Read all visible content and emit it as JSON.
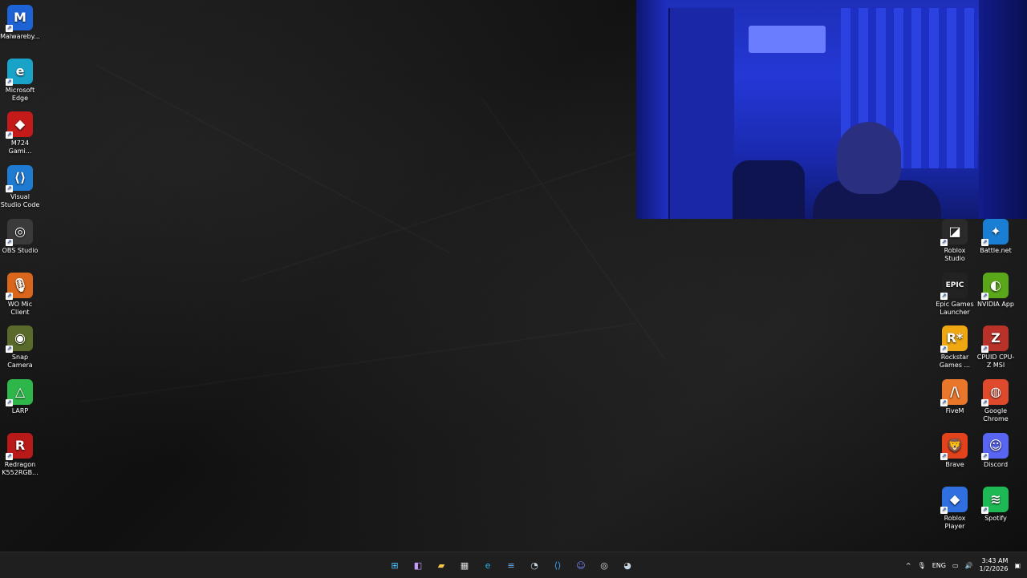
{
  "desktop": {
    "left_icons": [
      {
        "name": "malwarebytes",
        "label": "Malwareby...",
        "glyph": "M",
        "color": "#1e63d6"
      },
      {
        "name": "microsoft-edge",
        "label": "Microsoft Edge",
        "glyph": "e",
        "color": "#1aa3c9"
      },
      {
        "name": "m724-gaming",
        "label": "M724 Gami...",
        "glyph": "◆",
        "color": "#c41a1a"
      },
      {
        "name": "visual-studio-code",
        "label": "Visual Studio Code",
        "glyph": "⟨⟩",
        "color": "#1f7bd1"
      },
      {
        "name": "obs-studio",
        "label": "OBS Studio",
        "glyph": "◎",
        "color": "#3a3a3a"
      },
      {
        "name": "wo-mic-client",
        "label": "WO Mic Client",
        "glyph": "🎙",
        "color": "#d9661a"
      },
      {
        "name": "snap-camera",
        "label": "Snap Camera",
        "glyph": "◉",
        "color": "#5a6a2a"
      },
      {
        "name": "larp",
        "label": "LARP",
        "glyph": "△",
        "color": "#2fb64a"
      },
      {
        "name": "redragon-k552rgb",
        "label": "Redragon K552RGB...",
        "glyph": "R",
        "color": "#b81919"
      }
    ],
    "right_icons_col1": [
      {
        "name": "roblox-studio",
        "label": "Roblox Studio",
        "glyph": "◪",
        "color": "#2a2a2a"
      },
      {
        "name": "epic-games-launcher",
        "label": "Epic Games Launcher",
        "glyph": "EPIC",
        "color": "#222222"
      },
      {
        "name": "rockstar-games",
        "label": "Rockstar Games ...",
        "glyph": "R*",
        "color": "#f0a812"
      },
      {
        "name": "fivem",
        "label": "FiveM",
        "glyph": "/\\",
        "color": "#e8762b"
      },
      {
        "name": "brave",
        "label": "Brave",
        "glyph": "🦁",
        "color": "#e2431d"
      },
      {
        "name": "roblox-player",
        "label": "Roblox Player",
        "glyph": "◆",
        "color": "#2f6fe0"
      }
    ],
    "right_icons_col2": [
      {
        "name": "battle-net",
        "label": "Battle.net",
        "glyph": "✦",
        "color": "#1a7fd4"
      },
      {
        "name": "nvidia-app",
        "label": "NVIDIA App",
        "glyph": "◐",
        "color": "#5aa81a"
      },
      {
        "name": "cpuid-cpu-z-msi",
        "label": "CPUID CPU-Z MSI",
        "glyph": "Z",
        "color": "#b8322a"
      },
      {
        "name": "google-chrome",
        "label": "Google Chrome",
        "glyph": "◍",
        "color": "#e04a2c"
      },
      {
        "name": "discord",
        "label": "Discord",
        "glyph": "☺",
        "color": "#5865f2"
      },
      {
        "name": "spotify",
        "label": "Spotify",
        "glyph": "≋",
        "color": "#1db954"
      }
    ]
  },
  "taskbar": {
    "apps": [
      {
        "name": "start",
        "glyph": "⊞",
        "color": "#4cc2ff"
      },
      {
        "name": "widgets",
        "glyph": "◧",
        "color": "#c59bff"
      },
      {
        "name": "file-explorer",
        "glyph": "▰",
        "color": "#f4c74a"
      },
      {
        "name": "microsoft-store",
        "glyph": "▦",
        "color": "#dcdcdc"
      },
      {
        "name": "edge",
        "glyph": "e",
        "color": "#29b6e8"
      },
      {
        "name": "notepad",
        "glyph": "≡",
        "color": "#6fb7ff"
      },
      {
        "name": "steam",
        "glyph": "◔",
        "color": "#c7d5e0"
      },
      {
        "name": "vscode",
        "glyph": "⟨⟩",
        "color": "#3ea6ff"
      },
      {
        "name": "discord",
        "glyph": "☺",
        "color": "#7b86ff"
      },
      {
        "name": "obs",
        "glyph": "◎",
        "color": "#dddddd"
      },
      {
        "name": "steam-2",
        "glyph": "◕",
        "color": "#c7d5e0"
      }
    ],
    "tray": {
      "chevron": "^",
      "mic": "🎙",
      "language": "ENG",
      "network": "▭",
      "volume": "🔊",
      "time": "3:43 AM",
      "date": "1/2/2026",
      "notification": "▣"
    }
  }
}
